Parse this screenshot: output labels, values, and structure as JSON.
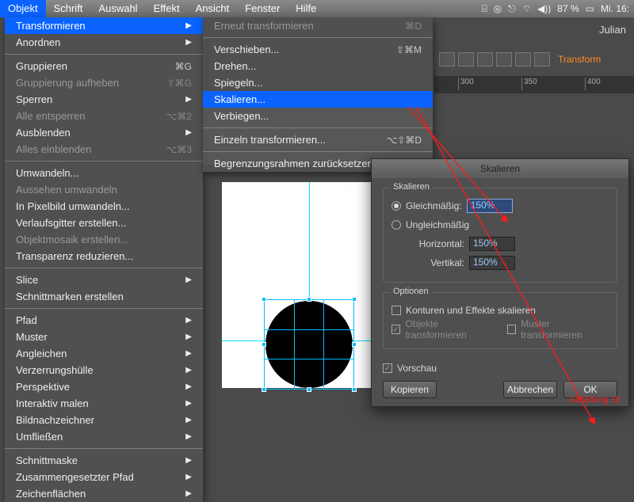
{
  "menubar": {
    "items": [
      "Objekt",
      "Schrift",
      "Auswahl",
      "Effekt",
      "Ansicht",
      "Fenster",
      "Hilfe"
    ],
    "active_index": 0,
    "status": {
      "battery_pct": "87 %",
      "clock": "Mi. 16:"
    }
  },
  "header": {
    "user": "Julian",
    "tab_label": "Transform"
  },
  "ruler_ticks": [
    "300",
    "350",
    "400"
  ],
  "menu": [
    {
      "label": "Transformieren",
      "arrow": true,
      "hl": true
    },
    {
      "label": "Anordnen",
      "arrow": true
    },
    {
      "sep": true
    },
    {
      "label": "Gruppieren",
      "shortcut": "⌘G"
    },
    {
      "label": "Gruppierung aufheben",
      "shortcut": "⇧⌘G",
      "dis": true
    },
    {
      "label": "Sperren",
      "arrow": true
    },
    {
      "label": "Alle entsperren",
      "shortcut": "⌥⌘2",
      "dis": true
    },
    {
      "label": "Ausblenden",
      "arrow": true
    },
    {
      "label": "Alles einblenden",
      "shortcut": "⌥⌘3",
      "dis": true
    },
    {
      "sep": true
    },
    {
      "label": "Umwandeln..."
    },
    {
      "label": "Aussehen umwandeln",
      "dis": true
    },
    {
      "label": "In Pixelbild umwandeln..."
    },
    {
      "label": "Verlaufsgitter erstellen..."
    },
    {
      "label": "Objektmosaik erstellen...",
      "dis": true
    },
    {
      "label": "Transparenz reduzieren..."
    },
    {
      "sep": true
    },
    {
      "label": "Slice",
      "arrow": true
    },
    {
      "label": "Schnittmarken erstellen"
    },
    {
      "sep": true
    },
    {
      "label": "Pfad",
      "arrow": true
    },
    {
      "label": "Muster",
      "arrow": true
    },
    {
      "label": "Angleichen",
      "arrow": true
    },
    {
      "label": "Verzerrungshülle",
      "arrow": true
    },
    {
      "label": "Perspektive",
      "arrow": true
    },
    {
      "label": "Interaktiv malen",
      "arrow": true
    },
    {
      "label": "Bildnachzeichner",
      "arrow": true
    },
    {
      "label": "Umfließen",
      "arrow": true
    },
    {
      "sep": true
    },
    {
      "label": "Schnittmaske",
      "arrow": true
    },
    {
      "label": "Zusammengesetzter Pfad",
      "arrow": true
    },
    {
      "label": "Zeichenflächen",
      "arrow": true
    }
  ],
  "submenu": [
    {
      "label": "Erneut transformieren",
      "shortcut": "⌘D",
      "dis": true
    },
    {
      "sep": true
    },
    {
      "label": "Verschieben...",
      "shortcut": "⇧⌘M"
    },
    {
      "label": "Drehen..."
    },
    {
      "label": "Spiegeln..."
    },
    {
      "label": "Skalieren...",
      "hl": true
    },
    {
      "label": "Verbiegen..."
    },
    {
      "sep": true
    },
    {
      "label": "Einzeln transformieren...",
      "shortcut": "⌥⇧⌘D"
    },
    {
      "sep": true
    },
    {
      "label": "Begrenzungsrahmen zurücksetzen"
    }
  ],
  "dialog": {
    "title": "Skalieren",
    "group_scale": "Skalieren",
    "uniform_label": "Gleichmäßig:",
    "uniform_value": "150%",
    "nonuniform_label": "Ungleichmäßig",
    "horizontal_label": "Horizontal:",
    "horizontal_value": "150%",
    "vertical_label": "Vertikal:",
    "vertical_value": "150%",
    "group_options": "Optionen",
    "opt_strokes": "Konturen und Effekte skalieren",
    "opt_objects": "Objekte transformieren",
    "opt_patterns": "Muster transformieren",
    "preview": "Vorschau",
    "btn_copy": "Kopieren",
    "btn_cancel": "Abbrechen",
    "btn_ok": "OK",
    "annotation": "Abbildung 18"
  }
}
